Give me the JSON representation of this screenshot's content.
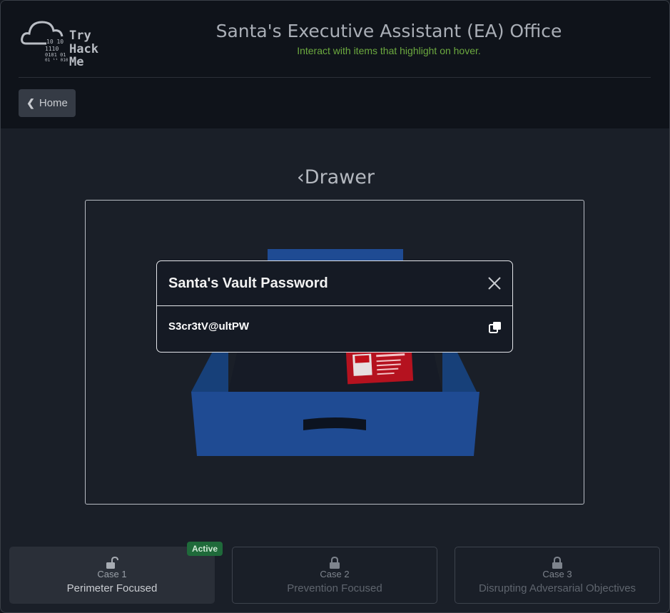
{
  "header": {
    "logo_lines": [
      "Try",
      "Hack",
      "Me"
    ],
    "title": "Santa's Executive Assistant (EA) Office",
    "subtitle": "Interact with items that highlight on hover.",
    "home_label": "Home"
  },
  "section": {
    "title": "Drawer"
  },
  "modal": {
    "title": "Santa's Vault Password",
    "password": "S3cr3tV@ultPW"
  },
  "cases": [
    {
      "number": "Case 1",
      "name": "Perimeter Focused",
      "badge": "Active",
      "status": "unlocked"
    },
    {
      "number": "Case 2",
      "name": "Prevention Focused",
      "status": "locked"
    },
    {
      "number": "Case 3",
      "name": "Disrupting Adversarial Objectives",
      "status": "locked"
    }
  ],
  "colors": {
    "accent_green": "#6ca93f",
    "drawer_blue": "#1f4b93",
    "badge_green": "#1f6a3a"
  },
  "icons": [
    "cloud-logo-icon",
    "chevron-left-icon",
    "close-icon",
    "copy-icon",
    "unlock-icon",
    "lock-icon"
  ]
}
